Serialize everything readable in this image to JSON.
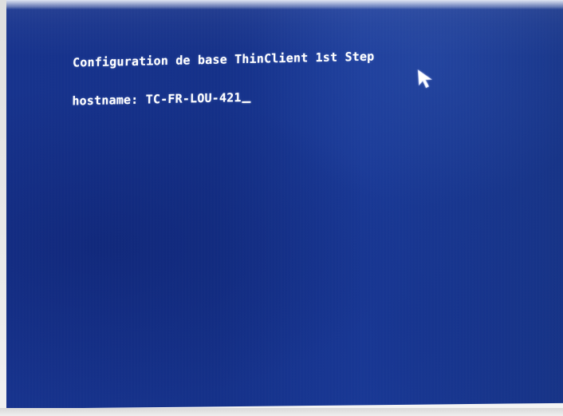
{
  "terminal": {
    "title": "Configuration de base ThinClient 1st Step",
    "prompt": {
      "label": "hostname:",
      "value": "TC-FR-LOU-421"
    }
  },
  "icons": {
    "cursor": "text-cursor-icon",
    "pointer": "mouse-pointer-icon"
  },
  "colors": {
    "background": "#163289",
    "text": "#ffffff"
  }
}
